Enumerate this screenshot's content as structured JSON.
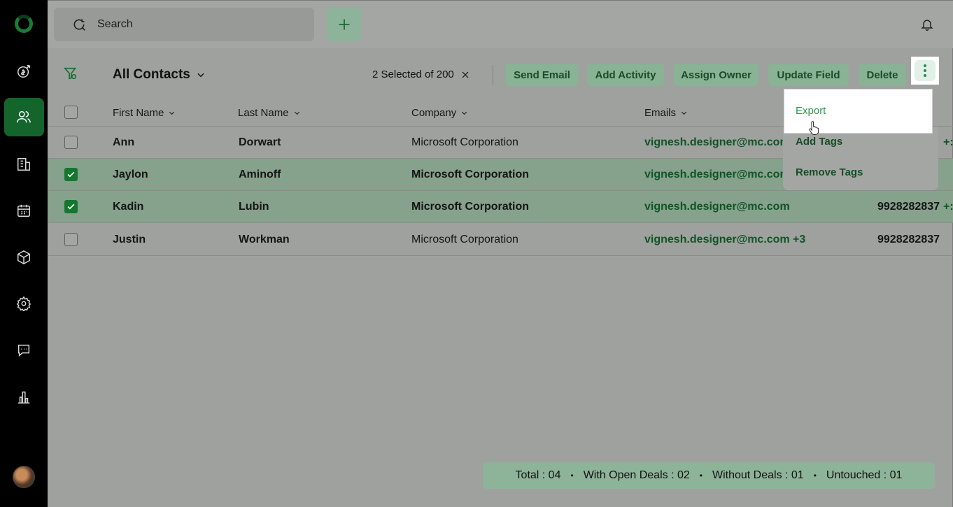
{
  "search": {
    "label": "Search"
  },
  "view": {
    "title": "All Contacts"
  },
  "selection": {
    "text": "2 Selected of 200"
  },
  "actions": {
    "send_email": "Send Email",
    "add_activity": "Add Activity",
    "assign_owner": "Assign Owner",
    "update_field": "Update Field",
    "delete": "Delete"
  },
  "columns": {
    "first_name": "First Name",
    "last_name": "Last Name",
    "company": "Company",
    "emails": "Emails"
  },
  "rows": [
    {
      "first": "Ann",
      "last": "Dorwart",
      "company": "Microsoft Corporation",
      "email": "vignesh.designer@mc.con",
      "extra": "+:",
      "phone": "",
      "selected": false
    },
    {
      "first": "Jaylon",
      "last": "Aminoff",
      "company": "Microsoft Corporation",
      "email": "vignesh.designer@mc.com",
      "extra": "",
      "phone": "",
      "selected": true
    },
    {
      "first": "Kadin",
      "last": "Lubin",
      "company": "Microsoft Corporation",
      "email": "vignesh.designer@mc.com",
      "extra": "+:",
      "phone": "9928282837",
      "selected": true
    },
    {
      "first": "Justin",
      "last": "Workman",
      "company": "Microsoft Corporation",
      "email": "vignesh.designer@mc.com",
      "extra": "+3",
      "phone": "9928282837",
      "selected": false
    }
  ],
  "menu": {
    "export": "Export",
    "add_tags": "Add Tags",
    "remove_tags": "Remove Tags"
  },
  "summary": {
    "total": "Total : 04",
    "open_deals": "With Open Deals : 02",
    "without_deals": "Without Deals : 01",
    "untouched": "Untouched : 01"
  },
  "colors": {
    "brand_green": "#15772f",
    "accent_light": "#2a9a4e"
  }
}
